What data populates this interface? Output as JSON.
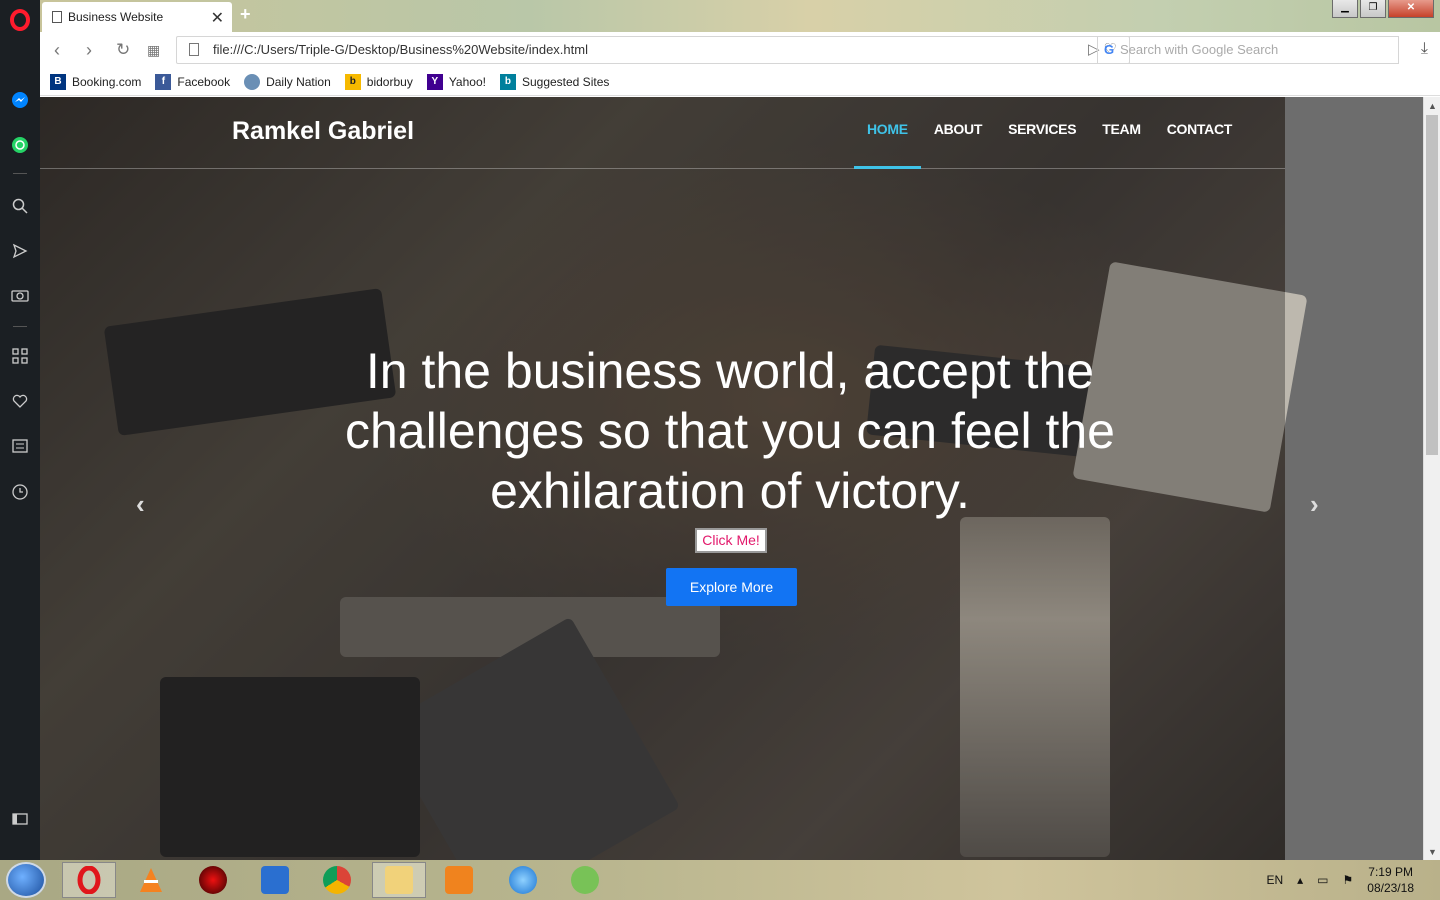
{
  "browser": {
    "tab_title": "Business Website",
    "url": "file:///C:/Users/Triple-G/Desktop/Business%20Website/index.html",
    "search_placeholder": "Search with Google Search",
    "bookmarks": [
      "Booking.com",
      "Facebook",
      "Daily Nation",
      "bidorbuy",
      "Yahoo!",
      "Suggested Sites"
    ]
  },
  "site": {
    "brand": "Ramkel Gabriel",
    "menu": [
      "HOME",
      "ABOUT",
      "SERVICES",
      "TEAM",
      "CONTACT"
    ],
    "active_menu": "HOME",
    "headline": "In the business world, accept the challenges so that you can feel the exhilaration of victory.",
    "click_me": "Click Me!",
    "explore": "Explore More",
    "accent_color": "#3fc3e8",
    "button_color": "#1274f3"
  },
  "taskbar": {
    "lang": "EN",
    "time": "7:19 PM",
    "date": "08/23/18"
  }
}
